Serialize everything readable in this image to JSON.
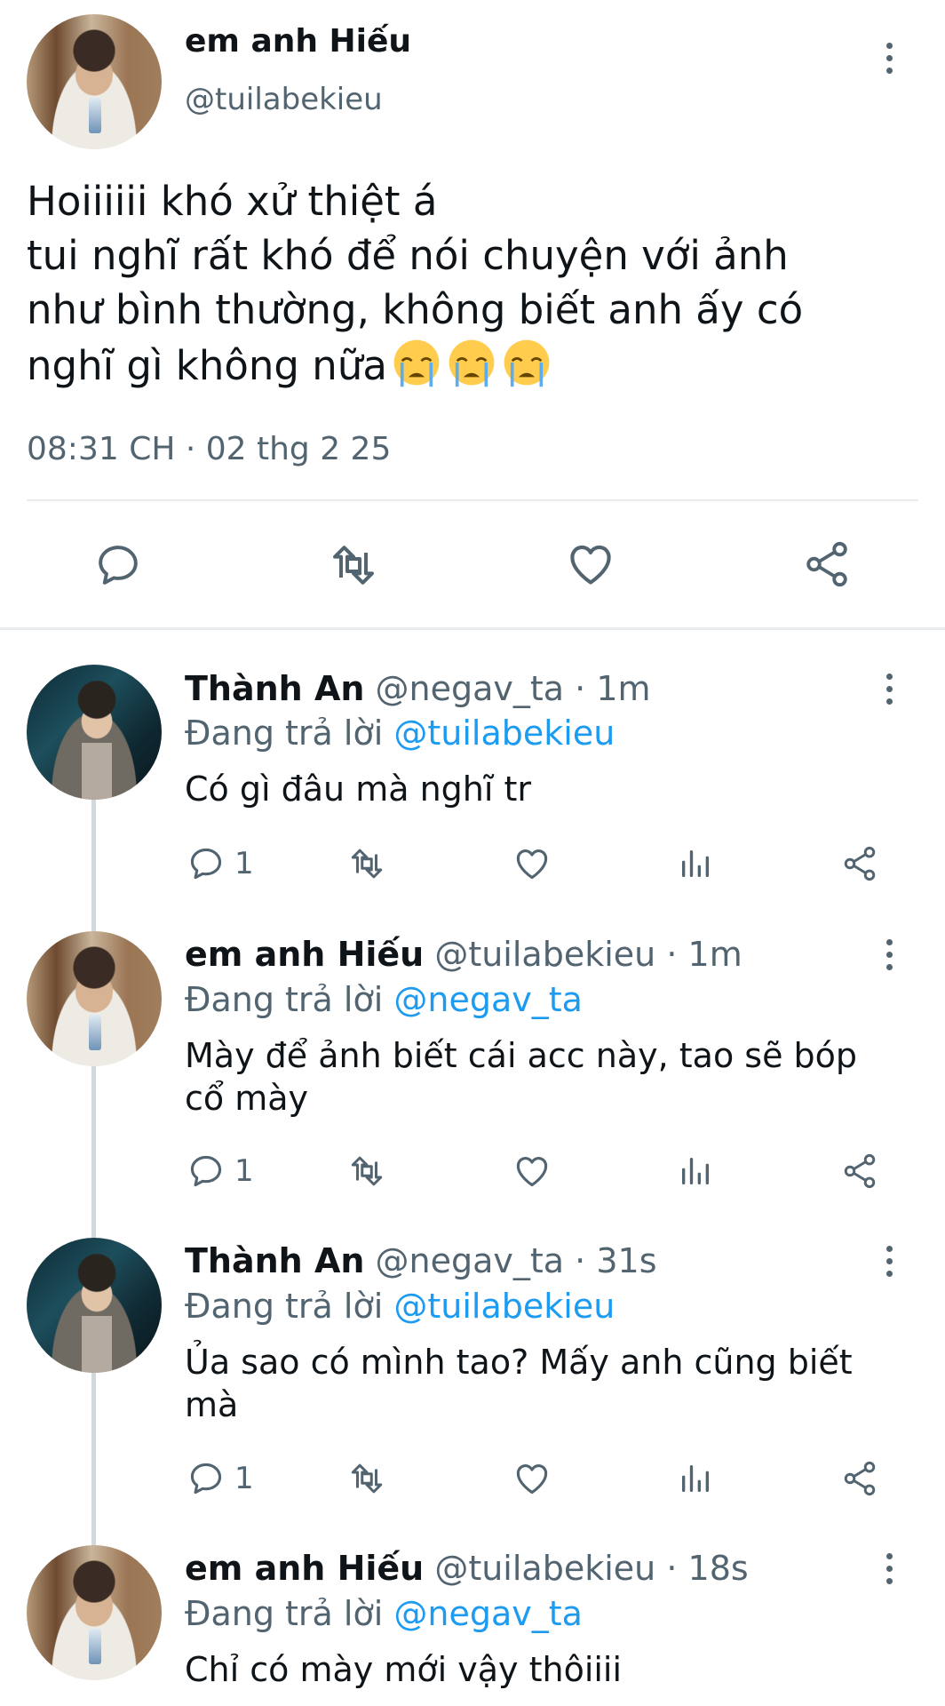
{
  "main_tweet": {
    "name": "em anh Hiếu",
    "handle": "@tuilabekieu",
    "text_lines": [
      "Hoiiiiii khó xử thiệt á",
      "tui nghĩ rất khó để nói chuyện với ảnh",
      "như bình thường, không biết anh ấy có",
      "nghĩ gì không nữa"
    ],
    "emoji": "loudly-crying-face",
    "timestamp": "08:31 CH · 02 thg 2 25"
  },
  "replies": [
    {
      "name": "Thành An",
      "handle": "@negav_ta",
      "sep": "·",
      "time": "1m",
      "replying_label": "Đang trả lời",
      "mention": "@tuilabekieu",
      "text": "Có gì đâu mà nghĩ tr",
      "reply_count": "1"
    },
    {
      "name": "em anh Hiếu",
      "handle": "@tuilabekieu",
      "sep": "·",
      "time": "1m",
      "replying_label": "Đang trả lời",
      "mention": "@negav_ta",
      "text": "Mày để ảnh biết cái acc này, tao sẽ bóp cổ mày",
      "reply_count": "1"
    },
    {
      "name": "Thành An",
      "handle": "@negav_ta",
      "sep": "·",
      "time": "31s",
      "replying_label": "Đang trả lời",
      "mention": "@tuilabekieu",
      "text": "Ủa sao có mình tao? Mấy anh cũng biết mà",
      "reply_count": "1"
    },
    {
      "name": "em anh Hiếu",
      "handle": "@tuilabekieu",
      "sep": "·",
      "time": "18s",
      "replying_label": "Đang trả lời",
      "mention": "@negav_ta",
      "text": "Chỉ có mày mới vậy thôiiii"
    }
  ],
  "icons": {
    "reply": "speech-bubble-icon",
    "retweet": "retweet-icon",
    "like": "heart-icon",
    "views": "bar-chart-icon",
    "share": "share-icon",
    "more": "vertical-ellipsis-icon"
  },
  "colors": {
    "text": "#0f1419",
    "secondary": "#536471",
    "link": "#1d9bf0",
    "divider": "#e9ecef",
    "thread_line": "#cfd9de"
  }
}
